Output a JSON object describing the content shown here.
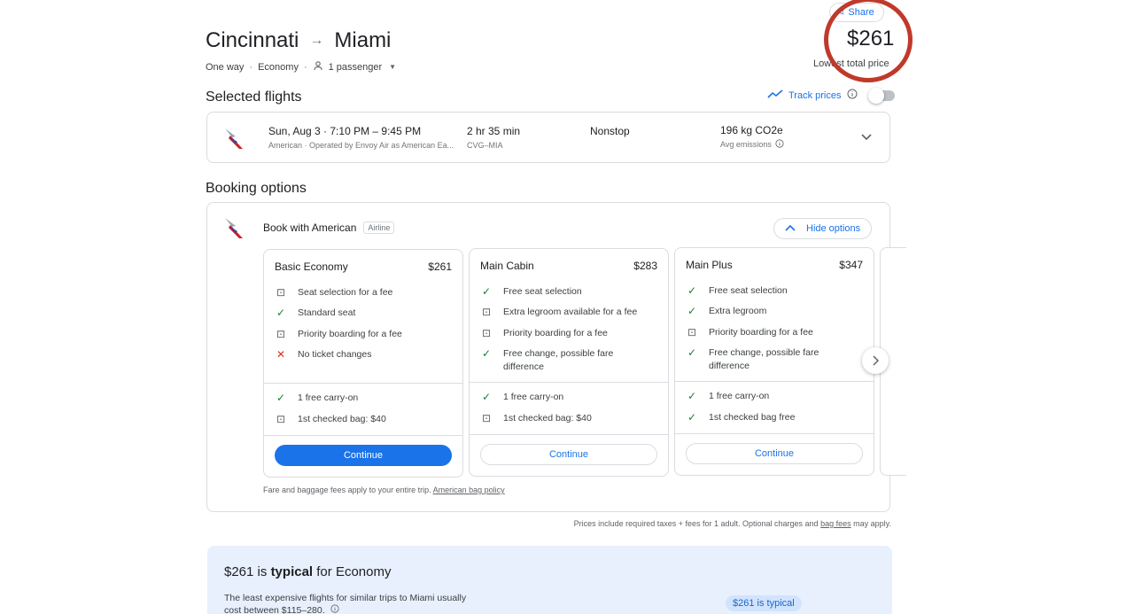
{
  "header": {
    "origin": "Cincinnati",
    "destination": "Miami",
    "trip_type": "One way",
    "cabin": "Economy",
    "passengers": "1 passenger",
    "share_label": "Share",
    "price": "$261",
    "price_caption": "Lowest total price"
  },
  "selected": {
    "heading": "Selected flights",
    "track_label": "Track prices",
    "flight": {
      "date_time": "Sun, Aug 3 · 7:10 PM – 9:45 PM",
      "operator": "American · Operated by Envoy Air as American Ea...",
      "duration": "2 hr 35 min",
      "route": "CVG–MIA",
      "stops": "Nonstop",
      "emissions": "196 kg CO2e",
      "emissions_caption": "Avg emissions"
    }
  },
  "booking": {
    "heading": "Booking options",
    "provider": "Book with American",
    "provider_tag": "Airline",
    "hide_label": "Hide options",
    "fares": [
      {
        "name": "Basic Economy",
        "price": "$261",
        "features": [
          {
            "icon": "bag",
            "text": "Seat selection for a fee"
          },
          {
            "icon": "check",
            "text": "Standard seat"
          },
          {
            "icon": "bag",
            "text": "Priority boarding for a fee"
          },
          {
            "icon": "x",
            "text": "No ticket changes"
          }
        ],
        "bags": [
          {
            "icon": "check",
            "text": "1 free carry-on"
          },
          {
            "icon": "bag",
            "text": "1st checked bag: $40"
          }
        ],
        "cta": "Continue"
      },
      {
        "name": "Main Cabin",
        "price": "$283",
        "features": [
          {
            "icon": "check",
            "text": "Free seat selection"
          },
          {
            "icon": "bag",
            "text": "Extra legroom available for a fee"
          },
          {
            "icon": "bag",
            "text": "Priority boarding for a fee"
          },
          {
            "icon": "check",
            "text": "Free change, possible fare difference"
          }
        ],
        "bags": [
          {
            "icon": "check",
            "text": "1 free carry-on"
          },
          {
            "icon": "bag",
            "text": "1st checked bag: $40"
          }
        ],
        "cta": "Continue"
      },
      {
        "name": "Main Plus",
        "price": "$347",
        "features": [
          {
            "icon": "check",
            "text": "Free seat selection"
          },
          {
            "icon": "check",
            "text": "Extra legroom"
          },
          {
            "icon": "bag",
            "text": "Priority boarding for a fee"
          },
          {
            "icon": "check",
            "text": "Free change, possible fare difference"
          }
        ],
        "bags": [
          {
            "icon": "check",
            "text": "1 free carry-on"
          },
          {
            "icon": "check",
            "text": "1st checked bag free"
          }
        ],
        "cta": "Continue"
      }
    ],
    "fee_note": "Fare and baggage fees apply to your entire trip.",
    "fee_link": "American bag policy"
  },
  "price_note": {
    "text": "Prices include required taxes + fees for 1 adult. Optional charges and",
    "link": "bag fees",
    "suffix": "may apply."
  },
  "insight": {
    "price": "$261",
    "is": "is",
    "typical": "typical",
    "for": "for Economy",
    "desc_line1": "The least expensive flights for similar trips to Miami usually",
    "desc_line2": "cost between $115–280.",
    "badge": "$261 is typical"
  },
  "colors": {
    "accent": "#1a73e8",
    "highlight_circle": "#c0392b",
    "check": "#188038",
    "x": "#d93025"
  }
}
